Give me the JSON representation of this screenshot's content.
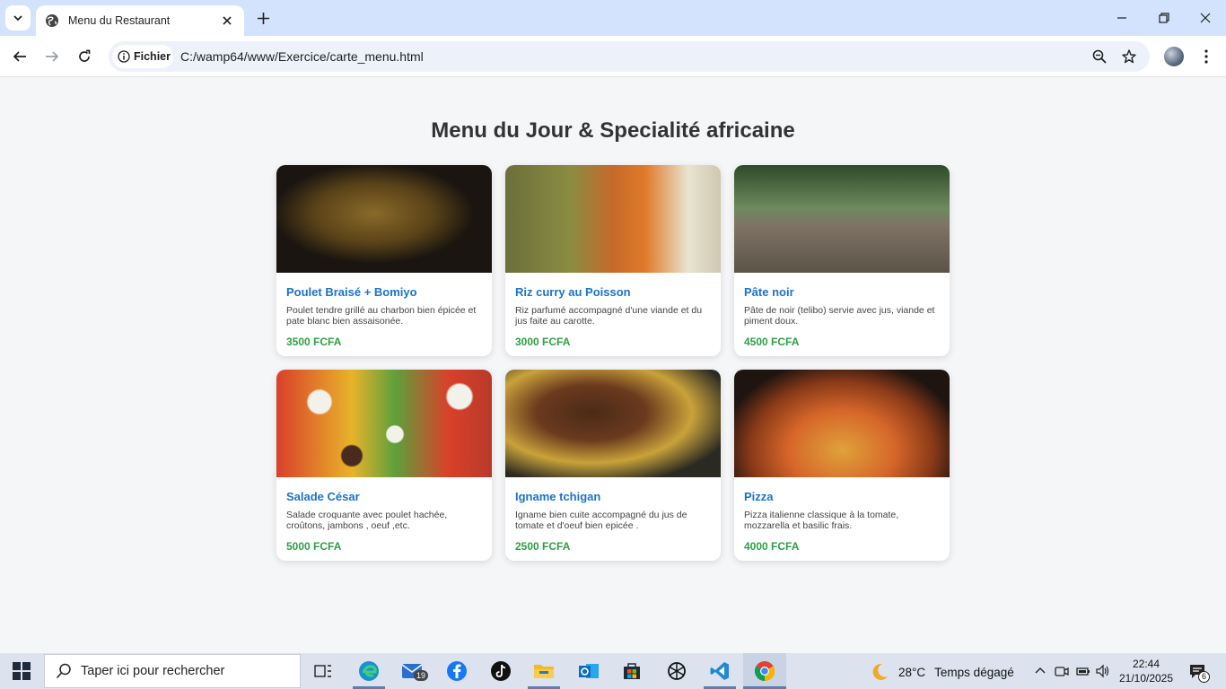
{
  "browser": {
    "tab_title": "Menu du Restaurant",
    "site_chip": "Fichier",
    "url": "C:/wamp64/www/Exercice/carte_menu.html"
  },
  "page": {
    "title": "Menu du Jour & Specialité africaine",
    "menu_items": [
      {
        "name": "Poulet Braisé + Bomiyo",
        "description": "Poulet tendre grillé au charbon bien épicée et pate blanc bien assaisonée.",
        "price": "3500 FCFA"
      },
      {
        "name": "Riz curry au Poisson",
        "description": "Riz parfumé accompagné d'une viande et du jus faite au carotte.",
        "price": "3000 FCFA"
      },
      {
        "name": "Pâte noir",
        "description": "Pâte de noir (telibo) servie avec jus, viande et piment doux.",
        "price": "4500 FCFA"
      },
      {
        "name": "Salade César",
        "description": "Salade croquante avec poulet hachée, croûtons, jambons , oeuf ,etc.",
        "price": "5000 FCFA"
      },
      {
        "name": "Igname tchigan",
        "description": "Igname bien cuite accompagné du jus de tomate et d'oeuf bien epicée .",
        "price": "2500 FCFA"
      },
      {
        "name": "Pizza",
        "description": "Pizza italienne classique à la tomate, mozzarella et basilic frais.",
        "price": "4000 FCFA"
      }
    ]
  },
  "taskbar": {
    "search_placeholder": "Taper ici pour rechercher",
    "mail_badge": "19",
    "weather_temp": "28°C",
    "weather_text": "Temps dégagé",
    "time": "22:44",
    "date": "21/10/2025",
    "notifications": "6"
  },
  "colors": {
    "item_name": "#1a73c9",
    "price": "#2e9e44",
    "tab_strip": "#d3e3fd"
  }
}
